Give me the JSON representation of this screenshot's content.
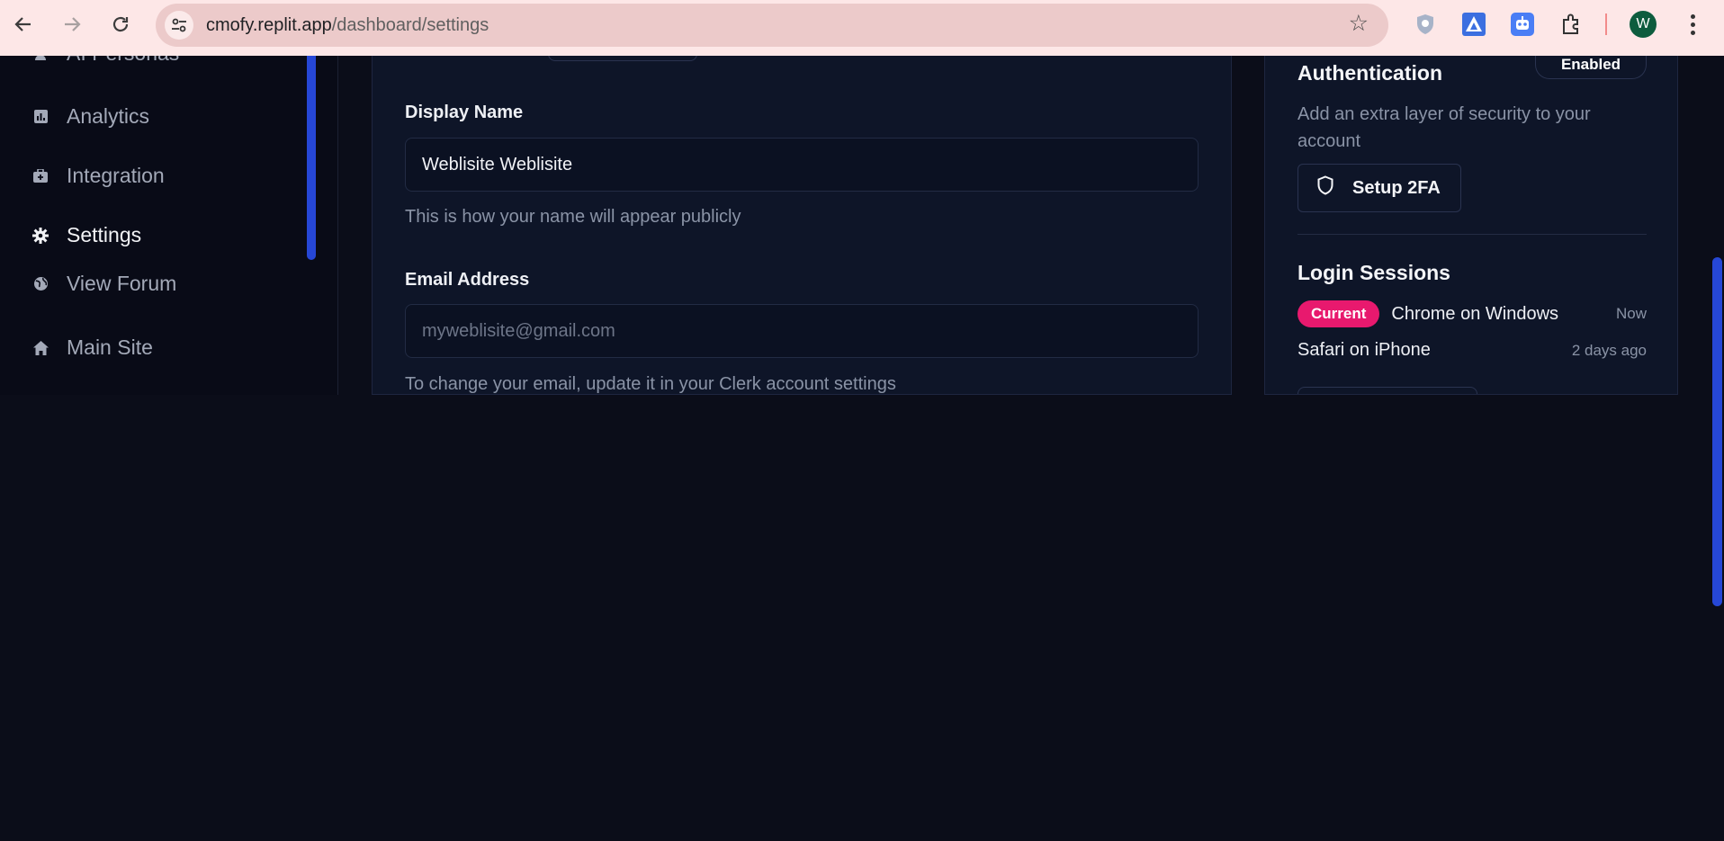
{
  "browser": {
    "url_host": "cmofy.replit.app",
    "url_path": "/dashboard/settings",
    "back_icon": "arrow-left",
    "forward_icon": "arrow-right",
    "reload_icon": "reload",
    "bookmark_icon": "star",
    "extensions": [
      "shield-extension",
      "triangle-extension",
      "robot-extension",
      "puzzle-extensions"
    ],
    "profile_initial": "W",
    "colors": {
      "bar": "#fde7e7",
      "omnibox": "#eccaca",
      "avatar": "#0d5c3e"
    }
  },
  "sidebar": {
    "items": [
      {
        "label": "AI Personas",
        "icon": "persona-icon"
      },
      {
        "label": "Analytics",
        "icon": "analytics-icon"
      },
      {
        "label": "Integration",
        "icon": "integration-icon"
      },
      {
        "label": "Settings",
        "icon": "gear-icon",
        "active": true
      },
      {
        "label": "View Forum",
        "icon": "globe-icon"
      },
      {
        "label": "Main Site",
        "icon": "home-icon"
      }
    ]
  },
  "profile_form": {
    "display_name": {
      "label": "Display Name",
      "value": "Weblisite Weblisite",
      "hint": "This is how your name will appear publicly"
    },
    "email": {
      "label": "Email Address",
      "placeholder": "myweblisite@gmail.com",
      "hint": "To change your email, update it in your Clerk account settings"
    }
  },
  "security": {
    "twofa": {
      "status": "Enabled",
      "title": "Authentication",
      "description": "Add an extra layer of security to your account",
      "button_label": "Setup 2FA",
      "button_icon": "shield-icon"
    },
    "sessions": {
      "title": "Login Sessions",
      "current_badge": "Current",
      "items": [
        {
          "device": "Chrome on Windows",
          "time": "Now",
          "current": true
        },
        {
          "device": "Safari on iPhone",
          "time": "2 days ago",
          "current": false
        }
      ]
    }
  },
  "theme": {
    "background": "#0b0d19",
    "panel": "#0e1528",
    "accent_blue": "#2647d6",
    "badge_pink": "#e8196e"
  }
}
